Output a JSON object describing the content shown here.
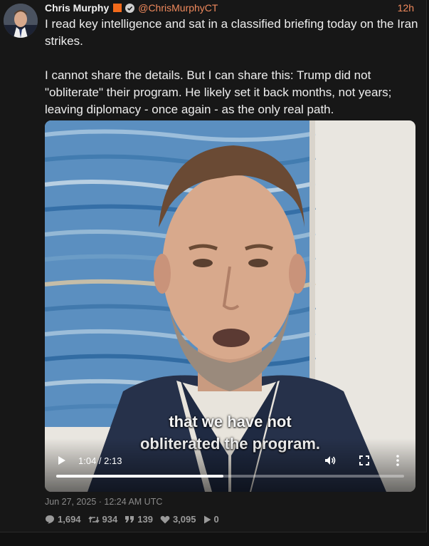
{
  "post": {
    "author_name": "Chris Murphy",
    "handle": "@ChrisMurphyCT",
    "relative_time": "12h",
    "text": "I read key intelligence and sat in a classified briefing today on the Iran strikes.\n\nI cannot share the details. But I can share this: Trump did not \"obliterate\" their program. He likely set it back months, not years; leaving diplomacy - once again - as the only real path.",
    "timestamp": "Jun 27, 2025 · 12:24 AM UTC"
  },
  "video": {
    "caption_line1": "that we have not",
    "caption_line2": "obliterated the program.",
    "time_display": "1:04 / 2:13",
    "progress": 0.48
  },
  "stats": {
    "replies": "1,694",
    "retweets": "934",
    "quotes": "139",
    "likes": "3,095",
    "views": "0"
  },
  "colors": {
    "accent": "#f08a5d",
    "badge": "#f26a1b",
    "background": "#171717"
  },
  "icons": [
    "reply-icon",
    "retweet-icon",
    "quote-icon",
    "like-icon",
    "play-count-icon",
    "play-icon",
    "volume-icon",
    "fullscreen-icon",
    "more-vertical-icon",
    "verified-icon"
  ]
}
